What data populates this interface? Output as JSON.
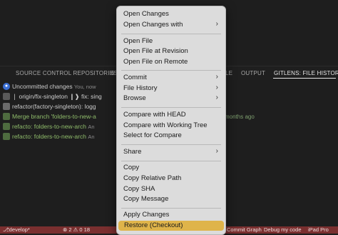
{
  "panel_tabs": [
    "SOURCE CONTROL REPOSITORIES",
    "6",
    "LE",
    "OUTPUT",
    "GITLENS: FILE HISTORY"
  ],
  "rows": [
    {
      "text": "Uncommitted changes",
      "sub": "You, now",
      "style": "normal"
    },
    {
      "text": "❘ origin/fix-singleton ❙❱  fix: sing",
      "sub": "",
      "style": "normal"
    },
    {
      "text": "refactor(factory-singleton): logg",
      "sub": "",
      "style": "normal"
    },
    {
      "text": "Merge branch 'folders-to-new-a",
      "sub": "",
      "style": "green"
    },
    {
      "text": "refacto: folders-to-new-arch",
      "sub": "An",
      "style": "green"
    },
    {
      "text": "refacto: folders-to-new-arch",
      "sub": "An",
      "style": "green"
    }
  ],
  "row_time": "months ago",
  "menu": {
    "groups": [
      [
        {
          "label": "Open Changes",
          "submenu": false
        },
        {
          "label": "Open Changes with",
          "submenu": true
        }
      ],
      [
        {
          "label": "Open File",
          "submenu": false
        },
        {
          "label": "Open File at Revision",
          "submenu": false
        },
        {
          "label": "Open File on Remote",
          "submenu": false
        }
      ],
      [
        {
          "label": "Commit",
          "submenu": true
        },
        {
          "label": "File History",
          "submenu": true
        },
        {
          "label": "Browse",
          "submenu": true
        }
      ],
      [
        {
          "label": "Compare with HEAD",
          "submenu": false
        },
        {
          "label": "Compare with Working Tree",
          "submenu": false
        },
        {
          "label": "Select for Compare",
          "submenu": false
        }
      ],
      [
        {
          "label": "Share",
          "submenu": true
        }
      ],
      [
        {
          "label": "Copy",
          "submenu": false
        },
        {
          "label": "Copy Relative Path",
          "submenu": false
        },
        {
          "label": "Copy SHA",
          "submenu": false
        },
        {
          "label": "Copy Message",
          "submenu": false
        }
      ],
      [
        {
          "label": "Apply Changes",
          "submenu": false
        },
        {
          "label": "Restore (Checkout)",
          "submenu": false,
          "highlighted": true
        }
      ]
    ],
    "chevron": "›"
  },
  "statusbar": {
    "branch": "develop*",
    "problems": "⊗ 2 ⚠ 0  18",
    "graph": "Commit Graph",
    "debug": "Debug my code",
    "device": "iPad Pro"
  },
  "colors": {
    "highlight": "#dfb44a",
    "statusbar": "#7a2f2f",
    "menu_bg": "#dcdcdc"
  }
}
